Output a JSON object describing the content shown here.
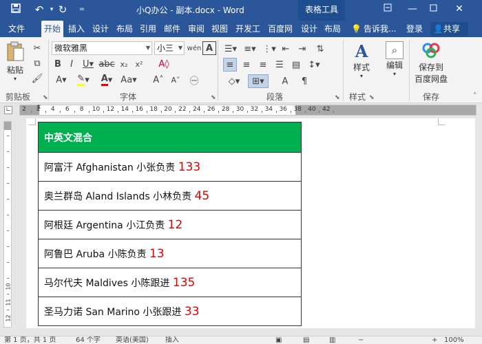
{
  "titlebar": {
    "title": "小Q办公 - 副本.docx - Word",
    "context_tools": "表格工具",
    "save_icon": "save-icon",
    "undo_icon": "undo-icon",
    "redo_icon": "redo-icon",
    "customize_icon": "customize-icon"
  },
  "tabs": [
    "文件",
    "开始",
    "插入",
    "设计",
    "布局",
    "引用",
    "邮件",
    "审阅",
    "视图",
    "开发工",
    "百度网",
    "设计",
    "布局"
  ],
  "active_tab": "开始",
  "tabs_right": {
    "tell_me": "告诉我...",
    "login": "登录",
    "share": "共享"
  },
  "ribbon": {
    "clipboard": {
      "paste_label": "粘贴",
      "group_label": "剪贴板"
    },
    "font": {
      "font_name": "微软雅黑",
      "font_size": "小三",
      "group_label": "字体"
    },
    "paragraph": {
      "group_label": "段落"
    },
    "styles": {
      "label": "样式",
      "group_label": "样式"
    },
    "editing": {
      "label": "编辑"
    },
    "save": {
      "label_line1": "保存到",
      "label_line2": "百度网盘",
      "group_label": "保存"
    }
  },
  "ruler": {
    "numbers": [
      "2",
      "2",
      "4",
      "6",
      "8",
      "10",
      "12",
      "14",
      "16",
      "18",
      "20",
      "22",
      "24",
      "26",
      "28",
      "30",
      "32",
      "34",
      "36",
      "38",
      "40",
      "42"
    ],
    "vertical_numbers": [
      "1",
      "2",
      "3",
      "4",
      "5",
      "6",
      "7",
      "8",
      "9",
      "10",
      "11",
      "12"
    ]
  },
  "table": {
    "header": "中英文混合",
    "rows": [
      {
        "text": "阿富汗 Afghanistan  小张负责 ",
        "num": "133"
      },
      {
        "text": "奥兰群岛 Aland Islands  小林负责 ",
        "num": "45"
      },
      {
        "text": "阿根廷 Argentina  小江负责 ",
        "num": "12"
      },
      {
        "text": "阿鲁巴 Aruba  小陈负责 ",
        "num": "13"
      },
      {
        "text": "马尔代夫 Maldives  小陈跟进 ",
        "num": "135"
      },
      {
        "text": "圣马力诺 San Marino  小张跟进 ",
        "num": "33"
      }
    ]
  },
  "status": {
    "page": "第 1 页，共 1 页",
    "words": "64 个字",
    "lang": "英语(美国)",
    "mode": "插入",
    "zoom": "100%"
  },
  "colors": {
    "title_bar": "#2b579a",
    "table_header": "#00b050",
    "number_red": "#e00000"
  }
}
